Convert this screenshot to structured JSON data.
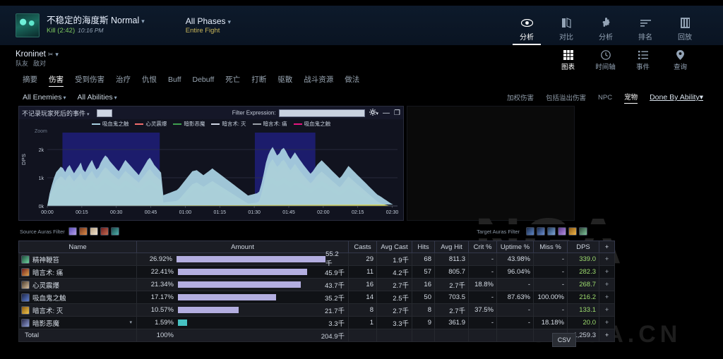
{
  "header": {
    "boss_name": "不稳定的海度斯 Normal",
    "caret": "▾",
    "kill_label": "Kill (2:42)",
    "kill_time": "10:16 PM",
    "phases_label": "All Phases",
    "phases_sub": "Entire Fight",
    "nav": [
      {
        "label": "分析",
        "icon": "eye-icon",
        "active": true
      },
      {
        "label": "对比",
        "icon": "compare-icon",
        "active": false
      },
      {
        "label": "分析",
        "icon": "puzzle-icon",
        "active": false
      },
      {
        "label": "排名",
        "icon": "ranking-icon",
        "active": false
      },
      {
        "label": "回放",
        "icon": "replay-icon",
        "active": false
      }
    ]
  },
  "player": {
    "name": "Kroninet",
    "class_glyph": "✂",
    "caret": "▾",
    "friendly": "队友",
    "enemy": "敌对",
    "nav": [
      {
        "label": "图表",
        "icon": "grid-icon",
        "active": true
      },
      {
        "label": "时间轴",
        "icon": "clock-icon",
        "active": false
      },
      {
        "label": "事件",
        "icon": "list-icon",
        "active": false
      },
      {
        "label": "查询",
        "icon": "pin-icon",
        "active": false
      }
    ]
  },
  "tabs": [
    {
      "label": "摘要",
      "active": false
    },
    {
      "label": "伤害",
      "active": true
    },
    {
      "label": "受到伤害",
      "active": false
    },
    {
      "label": "治疗",
      "active": false
    },
    {
      "label": "仇恨",
      "active": false
    },
    {
      "label": "Buff",
      "active": false
    },
    {
      "label": "Debuff",
      "active": false
    },
    {
      "label": "死亡",
      "active": false
    },
    {
      "label": "打断",
      "active": false
    },
    {
      "label": "驱散",
      "active": false
    },
    {
      "label": "战斗资源",
      "active": false
    },
    {
      "label": "做法",
      "active": false
    }
  ],
  "filters": {
    "left": [
      {
        "label": "All Enemies",
        "caret": "▾"
      },
      {
        "label": "All Abilities",
        "caret": "▾"
      }
    ],
    "right": [
      {
        "label": "加权伤害",
        "selected": false
      },
      {
        "label": "包括溢出伤害",
        "selected": false
      },
      {
        "label": "NPC",
        "selected": false
      },
      {
        "label": "宠物",
        "selected": true
      }
    ],
    "done_by": "Done By Ability",
    "done_by_caret": "▾"
  },
  "chart_panel": {
    "event_filter": "不记录玩家死后的事件",
    "event_caret": "▾",
    "filter_expression_label": "Filter Expression:",
    "filter_expression_value": "",
    "gear_icon": "gear-icon",
    "gear_caret": "▾",
    "minimize_icon": "minimize-icon",
    "maximize_icon": "maximize-icon",
    "zoom_label": "Zoom"
  },
  "chart_data": {
    "type": "area",
    "stacked": true,
    "title": "",
    "xlabel": "",
    "ylabel": "DPS",
    "ylim": [
      0,
      2600
    ],
    "yticks": [
      0,
      1000,
      2000
    ],
    "ytick_labels": [
      "0k",
      "1k",
      "2k"
    ],
    "grid": true,
    "legend_position": "top",
    "x_tick_labels": [
      "00:00",
      "00:15",
      "00:30",
      "00:45",
      "01:00",
      "01:15",
      "01:30",
      "01:45",
      "02:00",
      "02:15",
      "02:30"
    ],
    "x_range_seconds": [
      0,
      162
    ],
    "phase_bands": [
      {
        "start_seconds": 7,
        "end_seconds": 52,
        "color": "#1f1f7a"
      },
      {
        "start_seconds": 96,
        "end_seconds": 124,
        "color": "#1f1f7a"
      }
    ],
    "series": [
      {
        "name": "吸血鬼之触",
        "color": "#e6157f",
        "values": [
          0,
          180,
          300,
          420,
          520,
          560,
          610,
          590,
          520,
          600,
          640,
          560,
          500,
          560,
          620,
          680,
          560,
          520,
          600,
          660,
          720,
          640,
          560,
          600,
          680,
          740,
          800,
          760,
          700,
          660,
          620,
          580,
          540,
          600,
          660,
          720,
          680,
          640,
          600,
          560,
          520,
          480,
          540,
          600,
          660,
          720,
          760,
          700,
          640,
          600,
          560,
          520,
          0,
          0,
          0,
          0,
          0,
          0,
          0,
          40,
          120,
          200,
          280,
          360,
          440,
          520,
          560,
          600,
          560,
          520,
          480,
          520,
          560,
          600,
          640,
          600,
          560,
          520,
          480,
          440,
          400,
          360,
          320,
          280,
          240,
          200,
          160,
          120,
          80,
          40,
          0,
          0,
          0,
          0,
          0,
          40,
          200,
          400,
          600,
          700,
          760,
          800,
          740,
          680,
          700,
          760,
          800,
          760,
          700,
          660,
          700,
          740,
          700,
          660,
          620,
          580,
          540,
          500,
          460,
          500,
          560,
          620,
          660,
          700,
          660,
          620,
          580,
          540,
          500,
          460,
          420,
          380,
          420,
          480,
          540,
          600,
          560,
          520,
          480,
          440,
          400,
          360,
          320,
          280,
          240,
          200,
          160,
          120,
          80,
          60,
          40,
          20,
          10,
          0,
          0,
          0,
          0,
          0
        ]
      },
      {
        "name": "暗言术: 痛",
        "color": "#9aa0a8",
        "values": [
          0,
          60,
          90,
          120,
          140,
          150,
          160,
          150,
          140,
          160,
          170,
          150,
          140,
          150,
          160,
          180,
          150,
          140,
          160,
          180,
          190,
          170,
          150,
          160,
          180,
          200,
          210,
          200,
          190,
          180,
          170,
          160,
          150,
          160,
          180,
          190,
          180,
          170,
          160,
          150,
          140,
          130,
          145,
          160,
          175,
          190,
          200,
          185,
          170,
          160,
          150,
          140,
          120,
          130,
          140,
          150,
          160,
          170,
          180,
          190,
          200,
          210,
          220,
          230,
          240,
          250,
          240,
          230,
          220,
          210,
          200,
          210,
          220,
          230,
          240,
          230,
          220,
          210,
          200,
          190,
          180,
          170,
          160,
          150,
          140,
          130,
          120,
          110,
          100,
          90,
          80,
          90,
          100,
          110,
          120,
          130,
          150,
          170,
          190,
          200,
          210,
          220,
          205,
          190,
          195,
          205,
          215,
          205,
          190,
          180,
          190,
          200,
          190,
          180,
          170,
          160,
          150,
          140,
          130,
          140,
          155,
          170,
          180,
          190,
          180,
          170,
          160,
          150,
          140,
          130,
          120,
          110,
          120,
          135,
          150,
          165,
          155,
          145,
          135,
          125,
          115,
          105,
          95,
          85,
          75,
          65,
          55,
          45,
          35,
          30,
          25,
          18,
          12,
          8,
          5,
          0,
          0,
          0
        ]
      },
      {
        "name": "暗言术: 灭",
        "color": "#f26d6d",
        "values": [
          0,
          80,
          140,
          200,
          240,
          260,
          280,
          270,
          240,
          270,
          290,
          260,
          230,
          260,
          280,
          310,
          260,
          240,
          270,
          300,
          330,
          290,
          260,
          270,
          310,
          340,
          360,
          350,
          320,
          300,
          280,
          260,
          245,
          270,
          300,
          330,
          310,
          290,
          270,
          250,
          235,
          215,
          245,
          270,
          300,
          330,
          345,
          320,
          290,
          270,
          250,
          230,
          0,
          0,
          0,
          0,
          0,
          0,
          0,
          0,
          0,
          0,
          0,
          0,
          0,
          0,
          0,
          0,
          0,
          0,
          0,
          0,
          0,
          0,
          0,
          0,
          0,
          0,
          0,
          0,
          0,
          0,
          0,
          0,
          0,
          0,
          0,
          0,
          0,
          0,
          0,
          0,
          0,
          0,
          0,
          0,
          80,
          180,
          280,
          330,
          360,
          380,
          350,
          320,
          330,
          360,
          380,
          360,
          330,
          310,
          330,
          350,
          330,
          310,
          290,
          270,
          250,
          230,
          215,
          235,
          265,
          290,
          310,
          330,
          310,
          290,
          270,
          250,
          230,
          215,
          195,
          175,
          195,
          225,
          250,
          280,
          260,
          240,
          220,
          200,
          185,
          165,
          150,
          130,
          110,
          90,
          75,
          55,
          40,
          30,
          20,
          12,
          8,
          4,
          0,
          0,
          0,
          0
        ]
      },
      {
        "name": "暗影恶魔",
        "color": "#dbe04a",
        "values": [
          0,
          0,
          0,
          0,
          0,
          0,
          0,
          0,
          0,
          0,
          0,
          0,
          0,
          0,
          0,
          0,
          0,
          0,
          0,
          0,
          0,
          0,
          0,
          0,
          0,
          0,
          0,
          0,
          0,
          0,
          0,
          0,
          0,
          0,
          0,
          0,
          0,
          0,
          0,
          0,
          0,
          0,
          0,
          0,
          0,
          0,
          0,
          0,
          0,
          0,
          0,
          0,
          0,
          0,
          0,
          0,
          0,
          0,
          0,
          0,
          0,
          0,
          0,
          0,
          0,
          0,
          0,
          0,
          0,
          0,
          0,
          0,
          0,
          0,
          0,
          0,
          0,
          0,
          0,
          0,
          0,
          0,
          0,
          0,
          0,
          0,
          0,
          0,
          0,
          0,
          0,
          0,
          0,
          0,
          0,
          0,
          0,
          0,
          60,
          160,
          220,
          260,
          240,
          200,
          230,
          260,
          240,
          200,
          160,
          120,
          160,
          200,
          160,
          120,
          90,
          60,
          40,
          20,
          0,
          0,
          0,
          0,
          0,
          0,
          0,
          0,
          0,
          0,
          0,
          0,
          0,
          0,
          0,
          0,
          0,
          0,
          0,
          0,
          0,
          0,
          0,
          0,
          0,
          0,
          0,
          0,
          0,
          0,
          0,
          0,
          0,
          0,
          0,
          0,
          0,
          0
        ]
      },
      {
        "name": "心灵震爆",
        "color": "#a8cfe0",
        "values": [
          0,
          120,
          200,
          260,
          300,
          320,
          340,
          330,
          300,
          330,
          350,
          320,
          290,
          320,
          340,
          370,
          320,
          300,
          330,
          360,
          390,
          350,
          320,
          330,
          370,
          400,
          420,
          410,
          380,
          360,
          340,
          320,
          300,
          330,
          360,
          390,
          370,
          350,
          330,
          310,
          290,
          270,
          300,
          330,
          360,
          390,
          405,
          380,
          350,
          330,
          310,
          290,
          260,
          280,
          300,
          320,
          340,
          360,
          380,
          400,
          410,
          420,
          430,
          440,
          450,
          460,
          450,
          440,
          430,
          420,
          410,
          420,
          430,
          440,
          450,
          440,
          430,
          420,
          410,
          400,
          390,
          380,
          370,
          360,
          350,
          340,
          330,
          320,
          310,
          300,
          290,
          300,
          310,
          320,
          330,
          340,
          360,
          380,
          400,
          410,
          420,
          430,
          415,
          400,
          405,
          415,
          425,
          415,
          400,
          390,
          400,
          410,
          400,
          390,
          380,
          370,
          360,
          350,
          340,
          350,
          365,
          380,
          390,
          400,
          390,
          380,
          370,
          360,
          350,
          340,
          330,
          320,
          330,
          345,
          360,
          375,
          365,
          355,
          345,
          335,
          325,
          315,
          305,
          295,
          285,
          275,
          265,
          255,
          245,
          235,
          220,
          200,
          170,
          130,
          90,
          50,
          20,
          0
        ]
      }
    ]
  },
  "aura_filters": {
    "source_label": "Source Auras Filter",
    "target_label": "Target Auras Filter",
    "source_icons": [
      "aura-icon-1",
      "aura-icon-2",
      "aura-icon-3",
      "aura-icon-4",
      "aura-icon-5"
    ],
    "target_icons": [
      "aura-icon-1",
      "aura-icon-2",
      "aura-icon-3",
      "aura-icon-4",
      "aura-icon-5",
      "aura-icon-6"
    ]
  },
  "table": {
    "columns": [
      "Name",
      "Amount",
      "Casts",
      "Avg Cast",
      "Hits",
      "Avg Hit",
      "Crit %",
      "Uptime %",
      "Miss %",
      "DPS",
      "+"
    ],
    "rows": [
      {
        "name": "精神鞭笞",
        "pct": "26.92%",
        "bar_pct": 100,
        "bar_color": "purple",
        "amount": "55.2千",
        "casts": "29",
        "avg_cast": "1.9千",
        "hits": "68",
        "avg_hit": "811.3",
        "crit": "-",
        "uptime": "43.98%",
        "miss": "-",
        "dps": "339.0",
        "plus": "+"
      },
      {
        "name": "暗言术: 痛",
        "pct": "22.41%",
        "bar_pct": 83,
        "bar_color": "purple",
        "amount": "45.9千",
        "casts": "11",
        "avg_cast": "4.2千",
        "hits": "57",
        "avg_hit": "805.7",
        "crit": "-",
        "uptime": "96.04%",
        "miss": "-",
        "dps": "282.3",
        "plus": "+"
      },
      {
        "name": "心灵震爆",
        "pct": "21.34%",
        "bar_pct": 79,
        "bar_color": "purple",
        "amount": "43.7千",
        "casts": "16",
        "avg_cast": "2.7千",
        "hits": "16",
        "avg_hit": "2.7千",
        "crit": "18.8%",
        "uptime": "-",
        "miss": "-",
        "dps": "268.7",
        "plus": "+"
      },
      {
        "name": "吸血鬼之触",
        "pct": "17.17%",
        "bar_pct": 63,
        "bar_color": "purple",
        "amount": "35.2千",
        "casts": "14",
        "avg_cast": "2.5千",
        "hits": "50",
        "avg_hit": "703.5",
        "crit": "-",
        "uptime": "87.63%",
        "miss": "100.00%",
        "dps": "216.2",
        "plus": "+"
      },
      {
        "name": "暗言术: 灭",
        "pct": "10.57%",
        "bar_pct": 39,
        "bar_color": "purple",
        "amount": "21.7千",
        "casts": "8",
        "avg_cast": "2.7千",
        "hits": "8",
        "avg_hit": "2.7千",
        "crit": "37.5%",
        "uptime": "-",
        "miss": "-",
        "dps": "133.1",
        "plus": "+"
      },
      {
        "name": "暗影恶魔",
        "pct": "1.59%",
        "bar_pct": 6,
        "bar_color": "teal",
        "amount": "3.3千",
        "casts": "1",
        "avg_cast": "3.3千",
        "hits": "9",
        "avg_hit": "361.9",
        "crit": "-",
        "uptime": "-",
        "miss": "18.18%",
        "dps": "20.0",
        "plus": "+",
        "has_caret": true
      }
    ],
    "total": {
      "name": "Total",
      "pct": "100%",
      "amount": "204.9千",
      "dps": "1,259.3",
      "plus": "+"
    }
  },
  "csv_button": "CSV",
  "watermark": {
    "big": "NGA",
    "small": "BBS  NGA.CN"
  }
}
